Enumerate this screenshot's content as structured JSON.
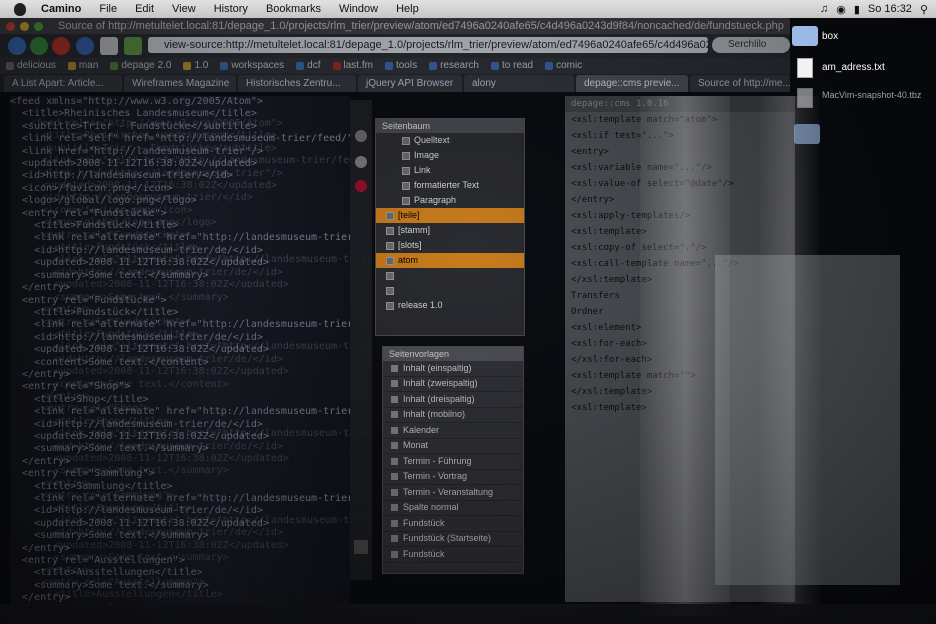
{
  "menubar": {
    "app": "Camino",
    "items": [
      "File",
      "Edit",
      "View",
      "History",
      "Bookmarks",
      "Window",
      "Help"
    ],
    "clock": "So 16:32"
  },
  "window": {
    "title": "Source of http://metultelet.local:81/depage_1.0/projects/rlm_trier/preview/atom/ed7496a0240afe65/c4d496a0243d9f84/noncached/de/fundstueck.php"
  },
  "toolbar": {
    "url": "view-source:http://metultelet.local:81/depage_1.0/projects/rlm_trier/preview/atom/ed7496a0240afe65/c4d496a0243d9f84/",
    "search_placeholder": "Serchlilo"
  },
  "bookmarks": [
    {
      "label": "delicious",
      "icon": "bookmark-icon"
    },
    {
      "label": "man",
      "icon": "star-icon"
    },
    {
      "label": "depage 2.0",
      "icon": "bookmark-icon"
    },
    {
      "label": "1.0",
      "icon": "star-icon"
    },
    {
      "label": "workspaces",
      "icon": "folder-icon"
    },
    {
      "label": "dcf",
      "icon": "folder-icon"
    },
    {
      "label": "last.fm",
      "icon": "lastfm-icon"
    },
    {
      "label": "tools",
      "icon": "folder-icon"
    },
    {
      "label": "research",
      "icon": "folder-icon"
    },
    {
      "label": "to read",
      "icon": "folder-icon"
    },
    {
      "label": "comic",
      "icon": "folder-icon"
    }
  ],
  "tabs": [
    {
      "label": "A List Apart: Article...",
      "active": false
    },
    {
      "label": "Wireframes Magazine",
      "active": false
    },
    {
      "label": "Historisches Zentru...",
      "active": false
    },
    {
      "label": "jQuery API Browser",
      "active": false
    },
    {
      "label": "alony",
      "active": false
    },
    {
      "label": "depage::cms previe...",
      "active": true
    },
    {
      "label": "Source of http://me...",
      "active": false
    }
  ],
  "source_lines": [
    "<feed xmlns=\"http://www.w3.org/2005/Atom\">",
    "  <title>Rheinisches Landesmuseum</title>",
    "  <subtitle>Trier - Fundstücke</subtitle>",
    "  <link rel=\"self\" href=\"http://landesmuseum-trier/feed/\"/>",
    "  <link href=\"http://landesmuseum-trier\"/>",
    "  <updated>2008-11-12T16:38:02Z</updated>",
    "  <id>http://landesmuseum-trier/</id>",
    "  <icon>/favicon.png</icon>",
    "  <logo>/global/logo.png</logo>",
    "  <entry rel=\"Fundstücke\">",
    "    <title>Fundstück</title>",
    "    <link rel=\"alternate\" href=\"http://landesmuseum-trier/de/\"/>",
    "    <id>http://landesmuseum-trier/de/</id>",
    "    <updated>2008-11-12T16:38:02Z</updated>",
    "    <summary>Some text.</summary>",
    "  </entry>",
    "  <entry rel=\"Fundstücke\">",
    "    <title>Fundstück</title>",
    "    <link rel=\"alternate\" href=\"http://landesmuseum-trier/\"/>",
    "    <id>http://landesmuseum-trier/de/</id>",
    "    <updated>2008-11-12T16:38:02Z</updated>",
    "    <content>Some text.</content>",
    "  </entry>",
    "  <entry rel=\"Shop\">",
    "    <title>Shop</title>",
    "    <link rel=\"alternate\" href=\"http://landesmuseum-trier/\"/>",
    "    <id>http://landesmuseum-trier/de/</id>",
    "    <updated>2008-11-12T16:38:02Z</updated>",
    "    <summary>Some text.</summary>",
    "  </entry>",
    "  <entry rel=\"Sammlung\">",
    "    <title>Sammlung</title>",
    "    <link rel=\"alternate\" href=\"http://landesmuseum-trier/\"/>",
    "    <id>http://landesmuseum-trier/de/</id>",
    "    <updated>2008-11-12T16:38:02Z</updated>",
    "    <summary>Some text.</summary>",
    "  </entry>",
    "  <entry rel=\"Ausstellungen\">",
    "    <title>Ausstellungen</title>",
    "    <summary>Some text.</summary>",
    "  </entry>",
    "</feed>"
  ],
  "tree_panel": {
    "header": "Seitenbaum",
    "items": [
      {
        "label": "Quelltext",
        "highlight": false
      },
      {
        "label": "Image",
        "highlight": false
      },
      {
        "label": "Link",
        "highlight": false
      },
      {
        "label": "formatierter Text",
        "highlight": false
      },
      {
        "label": "Paragraph",
        "highlight": false
      },
      {
        "label": "[teile]",
        "highlight": true
      },
      {
        "label": "[stamm]",
        "highlight": false
      },
      {
        "label": "[slots]",
        "highlight": false
      },
      {
        "label": "atom",
        "highlight": true
      },
      {
        "label": "",
        "highlight": false
      },
      {
        "label": "",
        "highlight": false
      },
      {
        "label": "release 1.0",
        "highlight": false
      }
    ]
  },
  "list_panel": {
    "header": "Seitenvorlagen",
    "items": [
      "Inhalt (einspaltig)",
      "Inhalt (zweispaltig)",
      "Inhalt (dreispaltig)",
      "Inhalt (mobilno)",
      "Kalender",
      "Monat",
      "Termin - Führung",
      "Termin - Vortrag",
      "Termin - Veranstaltung",
      "Spalte normal",
      "Fundstück",
      "Fundstück (Startseite)",
      "Fundstück"
    ]
  },
  "right_pane": {
    "title": "depage::cms 1.0.16",
    "lines": [
      "<xsl:template match=\"atom\">",
      "  <xsl:if test=\"...\">",
      "  <entry>",
      "    <xsl:variable name=\"...\"/>",
      "    <xsl:value-of select=\"@date\"/>",
      "  </entry>",
      "  <xsl:apply-templates/>",
      "<xsl:template>",
      "  <xsl:copy-of select=\".\"/>",
      "  <xsl:call-template name=\"...\"/>",
      "</xsl:template>",
      "Transfers",
      "  Ordner",
      "  <xsl:element>",
      "  <xsl:for-each>",
      "  </xsl:for-each>",
      "<xsl:template match=\"\">",
      "</xsl:template>",
      "<xsl:template>"
    ]
  },
  "desktop_icons": [
    {
      "label": "box",
      "kind": "folder"
    },
    {
      "label": "am_adress.txt",
      "kind": "file"
    },
    {
      "label": "MacVim-snapshot-40.tbz",
      "kind": "file"
    },
    {
      "label": "",
      "kind": "folder"
    }
  ],
  "colors": {
    "highlight": "#e08a1f",
    "accent": "#4a90e2"
  }
}
